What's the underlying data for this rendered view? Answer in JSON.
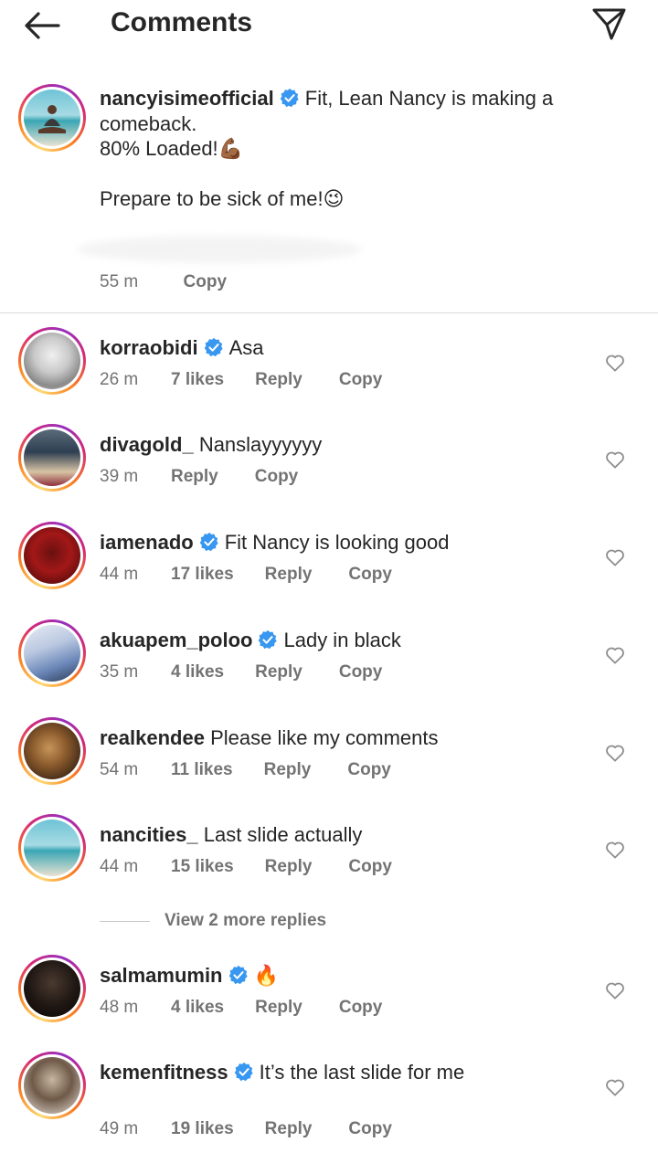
{
  "header": {
    "title": "Comments"
  },
  "caption": {
    "username": "nancyisimeofficial",
    "lines": [
      "Fit, Lean Nancy is making a",
      "comeback.",
      "80% Loaded!💪🏾",
      "",
      "Prepare to be sick of me!😉"
    ],
    "time": "55 m",
    "copy_label": "Copy"
  },
  "comments": [
    {
      "username": "korraobidi",
      "verified": true,
      "text": "Asa",
      "time": "26 m",
      "likes": "7 likes",
      "reply": "Reply",
      "copy": "Copy"
    },
    {
      "username": "divagold_",
      "verified": false,
      "text": "Nanslayyyyyy",
      "time": "39 m",
      "likes": "",
      "reply": "Reply",
      "copy": "Copy"
    },
    {
      "username": "iamenado",
      "verified": true,
      "text": "Fit Nancy is looking good",
      "time": "44 m",
      "likes": "17 likes",
      "reply": "Reply",
      "copy": "Copy"
    },
    {
      "username": "akuapem_poloo",
      "verified": true,
      "text": "Lady in black",
      "time": "35 m",
      "likes": "4 likes",
      "reply": "Reply",
      "copy": "Copy"
    },
    {
      "username": "realkendee",
      "verified": false,
      "text": "Please like my comments",
      "time": "54 m",
      "likes": "11 likes",
      "reply": "Reply",
      "copy": "Copy"
    },
    {
      "username": "nancities_",
      "verified": false,
      "text": "Last slide actually",
      "time": "44 m",
      "likes": "15 likes",
      "reply": "Reply",
      "copy": "Copy"
    },
    {
      "username": "salmamumin",
      "verified": true,
      "text": "🔥",
      "time": "48 m",
      "likes": "4 likes",
      "reply": "Reply",
      "copy": "Copy"
    },
    {
      "username": "kemenfitness",
      "verified": true,
      "text": "It’s the last slide for me",
      "time": "49 m",
      "likes": "19 likes",
      "reply": "Reply",
      "copy": "Copy"
    }
  ],
  "view_more_replies": "View 2 more replies",
  "colors": {
    "verified": "#3897f0",
    "meta_text": "#737373",
    "text": "#262626"
  }
}
